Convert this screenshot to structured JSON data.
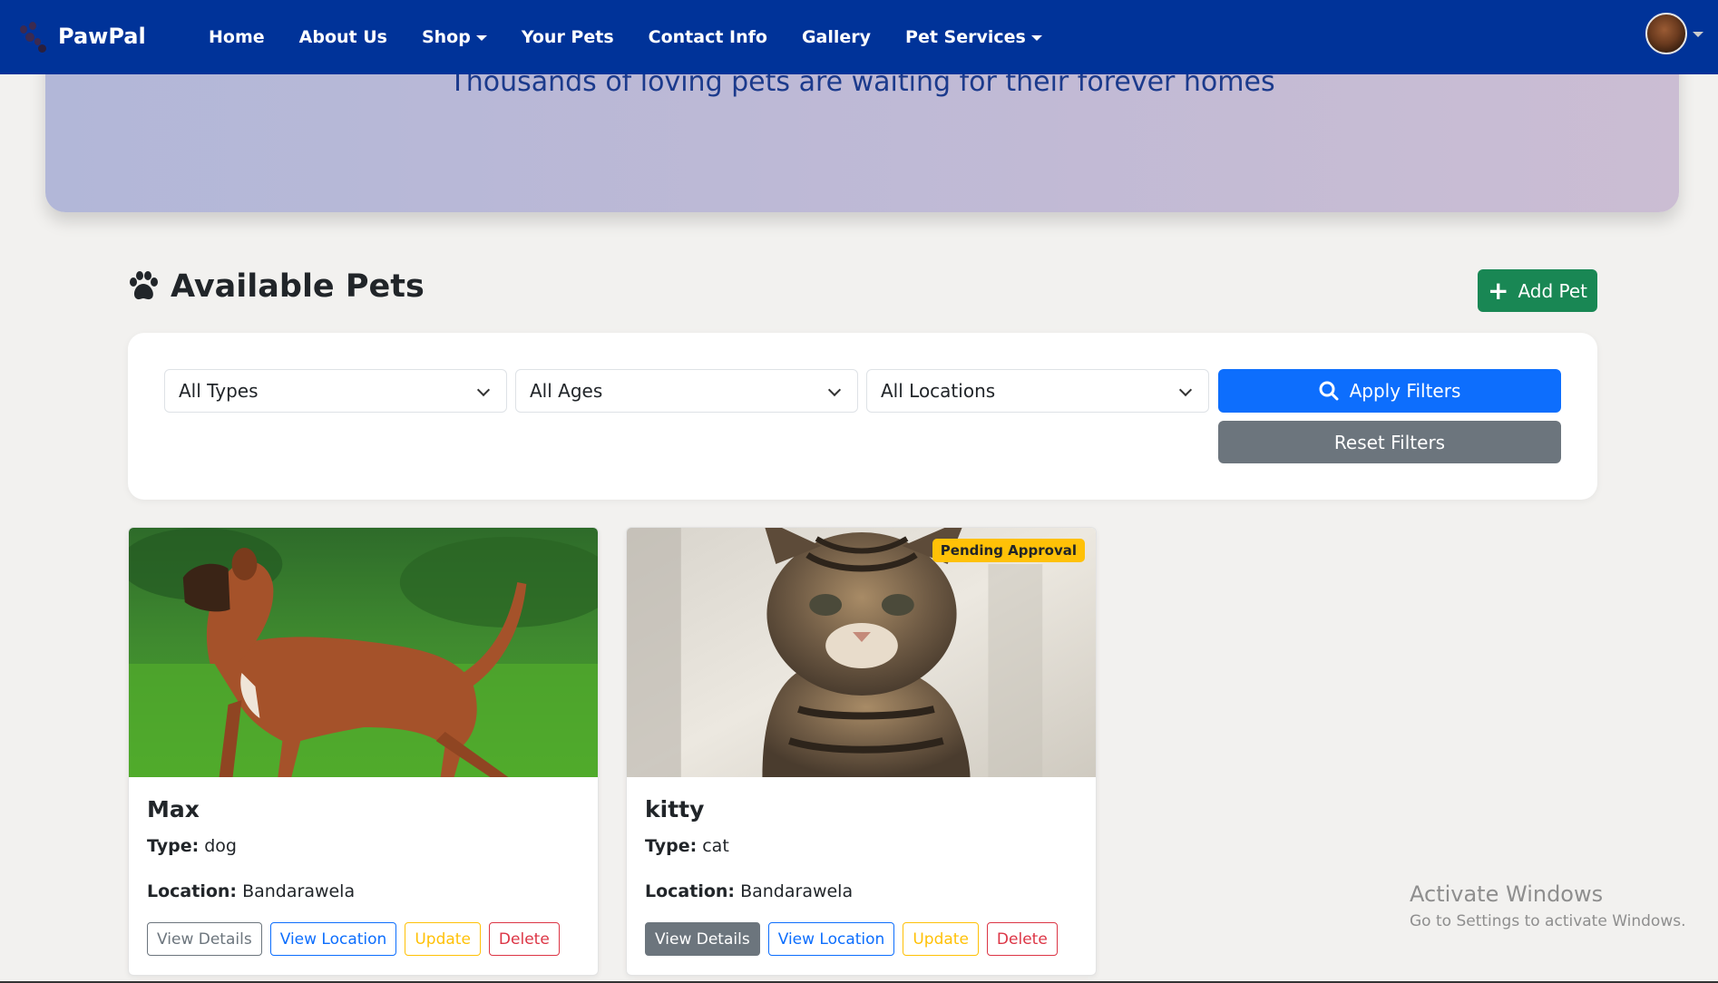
{
  "navbar": {
    "brand": "PawPal",
    "links": [
      {
        "label": "Home",
        "dropdown": false
      },
      {
        "label": "About Us",
        "dropdown": false
      },
      {
        "label": "Shop",
        "dropdown": true
      },
      {
        "label": "Your Pets",
        "dropdown": false
      },
      {
        "label": "Contact Info",
        "dropdown": false
      },
      {
        "label": "Gallery",
        "dropdown": false
      },
      {
        "label": "Pet Services",
        "dropdown": true
      }
    ],
    "color": "#003399"
  },
  "hero": {
    "subtitle": "Thousands of loving pets are waiting for their forever homes"
  },
  "section": {
    "title": "Available Pets",
    "add_button": "Add Pet"
  },
  "filters": {
    "type_select": "All Types",
    "age_select": "All Ages",
    "location_select": "All Locations",
    "apply_button": "Apply Filters",
    "reset_button": "Reset Filters"
  },
  "pets": [
    {
      "name": "Max",
      "type_label": "Type:",
      "type": "dog",
      "location_label": "Location:",
      "location": "Bandarawela",
      "badge": "",
      "buttons": {
        "details": "View Details",
        "location": "View Location",
        "update": "Update",
        "delete": "Delete"
      }
    },
    {
      "name": "kitty",
      "type_label": "Type:",
      "type": "cat",
      "location_label": "Location:",
      "location": "Bandarawela",
      "badge": "Pending Approval",
      "buttons": {
        "details": "View Details",
        "location": "View Location",
        "update": "Update",
        "delete": "Delete"
      }
    }
  ],
  "watermark": {
    "line1": "Activate Windows",
    "line2": "Go to Settings to activate Windows."
  },
  "colors": {
    "primary": "#0d6efd",
    "success": "#198754",
    "secondary": "#6c757d",
    "warning": "#ffc107",
    "danger": "#dc3545"
  }
}
